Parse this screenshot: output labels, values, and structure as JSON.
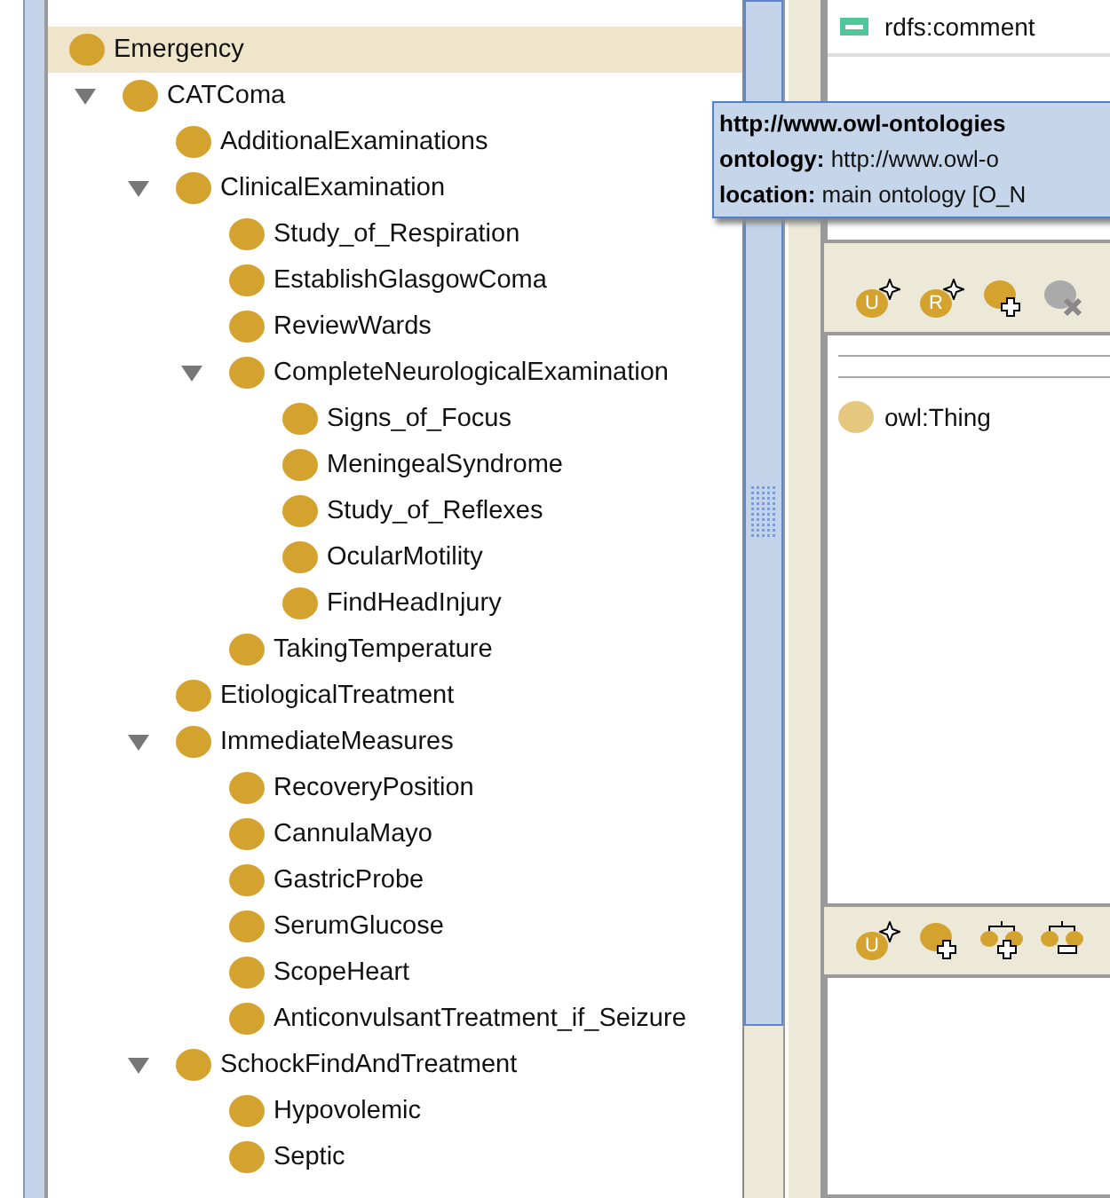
{
  "class_tree": {
    "items": [
      {
        "label": "Emergency",
        "selected": true,
        "children": [
          {
            "label": "CATComa",
            "selected": false,
            "expanded": true,
            "children": [
              {
                "label": "AdditionalExaminations",
                "selected": false,
                "expanded": false
              },
              {
                "label": "ClinicalExamination",
                "selected": false,
                "expanded": true,
                "children": [
                  {
                    "label": "Study_of_Respiration",
                    "selected": false,
                    "expanded": false
                  },
                  {
                    "label": "EstablishGlasgowComa",
                    "selected": false,
                    "expanded": false
                  },
                  {
                    "label": "ReviewWards",
                    "selected": false,
                    "expanded": false
                  },
                  {
                    "label": "CompleteNeurologicalExamination",
                    "selected": false,
                    "expanded": true,
                    "children": [
                      {
                        "label": "Signs_of_Focus",
                        "selected": false,
                        "expanded": false
                      },
                      {
                        "label": "MeningealSyndrome",
                        "selected": false,
                        "expanded": false
                      },
                      {
                        "label": "Study_of_Reflexes",
                        "selected": false,
                        "expanded": false
                      },
                      {
                        "label": "OcularMotility",
                        "selected": false,
                        "expanded": false
                      },
                      {
                        "label": "FindHeadInjury",
                        "selected": false,
                        "expanded": false
                      }
                    ]
                  },
                  {
                    "label": "TakingTemperature",
                    "selected": false,
                    "expanded": false
                  }
                ]
              },
              {
                "label": "EtiologicalTreatment",
                "selected": false,
                "expanded": false
              },
              {
                "label": "ImmediateMeasures",
                "selected": false,
                "expanded": true,
                "children": [
                  {
                    "label": "RecoveryPosition",
                    "selected": false,
                    "expanded": false
                  },
                  {
                    "label": "CannulaMayo",
                    "selected": false,
                    "expanded": false
                  },
                  {
                    "label": "GastricProbe",
                    "selected": false,
                    "expanded": false
                  },
                  {
                    "label": "SerumGlucose",
                    "selected": false,
                    "expanded": false
                  },
                  {
                    "label": "ScopeHeart",
                    "selected": false,
                    "expanded": false
                  },
                  {
                    "label": "AnticonvulsantTreatment_if_Seizure",
                    "selected": false,
                    "expanded": false
                  }
                ]
              },
              {
                "label": "SchockFindAndTreatment",
                "selected": false,
                "expanded": true,
                "children": [
                  {
                    "label": "Hypovolemic",
                    "selected": false,
                    "expanded": false
                  },
                  {
                    "label": "Septic",
                    "selected": false,
                    "expanded": false
                  }
                ]
              }
            ]
          }
        ]
      }
    ]
  },
  "annotations": {
    "items": [
      {
        "label": "rdfs:comment"
      }
    ]
  },
  "tooltip": {
    "lines": [
      "**http://www.owl-ontologies**",
      "**ontology:** http://www.owl-o",
      "**location:** main ontology [O_N"
    ]
  },
  "superclass_toolbar": {
    "buttons": [
      {
        "kind": "letter",
        "letter": "U",
        "disabled": false
      },
      {
        "kind": "letter",
        "letter": "R",
        "disabled": false
      },
      {
        "kind": "add",
        "disabled": false
      },
      {
        "kind": "delete",
        "disabled": true
      }
    ]
  },
  "superclasses": {
    "items": [
      {
        "label": "owl:Thing"
      }
    ]
  },
  "disjoint_toolbar": {
    "buttons": [
      {
        "kind": "letter",
        "letter": "U",
        "disabled": false
      },
      {
        "kind": "add",
        "disabled": false
      },
      {
        "kind": "add-sibling",
        "disabled": false
      },
      {
        "kind": "remove-sibling",
        "disabled": false
      }
    ]
  }
}
